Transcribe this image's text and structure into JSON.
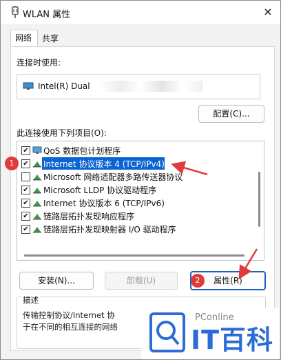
{
  "window": {
    "title": "WLAN 属性",
    "close_glyph": "✕"
  },
  "tabs": [
    {
      "label": "网络"
    },
    {
      "label": "共享"
    }
  ],
  "connect_using": {
    "label": "连接时使用:",
    "adapter_name": "Intel(R) Dual",
    "adapter_icon": "network-adapter-icon"
  },
  "configure_button": "配置(C)...",
  "items_label": "此连接使用下列项目(O):",
  "items": [
    {
      "label": "QoS 数据包计划程序",
      "checked": true,
      "icon": "qos-icon"
    },
    {
      "label": "Internet 协议版本 4 (TCP/IPv4)",
      "checked": true,
      "selected": true,
      "icon": "network-protocol-icon"
    },
    {
      "label": "Microsoft 网络适配器多路传送器协议",
      "checked": false,
      "icon": "network-protocol-icon"
    },
    {
      "label": "Microsoft LLDP 协议驱动程序",
      "checked": true,
      "icon": "network-protocol-icon"
    },
    {
      "label": "Internet 协议版本 6 (TCP/IPv6)",
      "checked": true,
      "icon": "network-protocol-icon"
    },
    {
      "label": "链路层拓扑发现响应程序",
      "checked": true,
      "icon": "network-protocol-icon"
    },
    {
      "label": "链路层拓扑发现映射器 I/O 驱动程序",
      "checked": true,
      "icon": "network-protocol-icon"
    }
  ],
  "buttons": {
    "install": "安装(N)...",
    "uninstall": "卸载(U)",
    "properties": "属性(R)"
  },
  "description": {
    "legend": "描述",
    "line1": "传输控制协议/Internet 协",
    "line2": "于在不同的相互连接的网络"
  },
  "markers": {
    "one": "1",
    "two": "2"
  },
  "colors": {
    "selection": "#0a64d2",
    "marker": "#e03a3a",
    "focus_border": "#1f5fbf",
    "watermark": "#2b6cd6"
  },
  "watermark": {
    "en": "PConline",
    "cn": "IT百科"
  }
}
